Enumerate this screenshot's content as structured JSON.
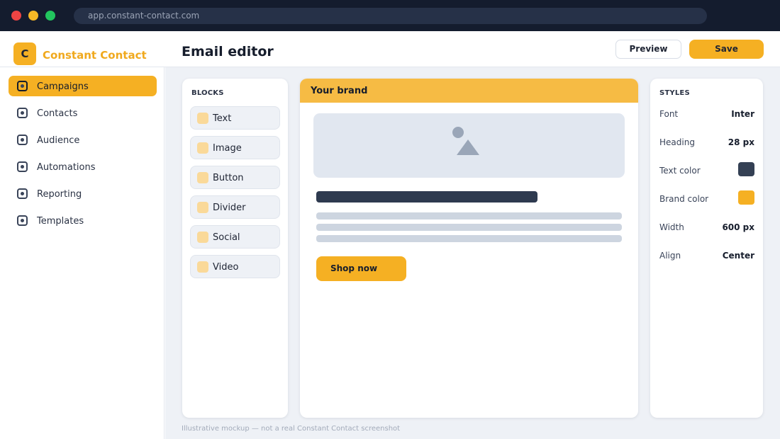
{
  "browser": {
    "url": "app.constant-contact.com"
  },
  "brand": {
    "logo_letter": "C",
    "name": "Constant Contact"
  },
  "header": {
    "title": "Email editor",
    "preview_label": "Preview",
    "save_label": "Save"
  },
  "sidebar": {
    "items": [
      {
        "label": "Campaigns",
        "active": true,
        "icon": "campaigns-icon"
      },
      {
        "label": "Contacts",
        "active": false,
        "icon": "contacts-icon"
      },
      {
        "label": "Audience",
        "active": false,
        "icon": "audience-icon"
      },
      {
        "label": "Automations",
        "active": false,
        "icon": "automations-icon"
      },
      {
        "label": "Reporting",
        "active": false,
        "icon": "reporting-icon"
      },
      {
        "label": "Templates",
        "active": false,
        "icon": "templates-icon"
      }
    ]
  },
  "blocks": {
    "heading": "BLOCKS",
    "items": [
      {
        "label": "Text"
      },
      {
        "label": "Image"
      },
      {
        "label": "Button"
      },
      {
        "label": "Divider"
      },
      {
        "label": "Social"
      },
      {
        "label": "Video"
      }
    ]
  },
  "canvas": {
    "header": "Your brand",
    "image_placeholder_icon": "image-icon",
    "button_label": "Shop now"
  },
  "styles": {
    "heading": "STYLES",
    "font": {
      "label": "Font",
      "value": "Inter"
    },
    "heading_size": {
      "label": "Heading",
      "value": "28 px"
    },
    "text_color": {
      "label": "Text color",
      "value": "#344054"
    },
    "brand_color": {
      "label": "Brand color",
      "value": "#f5b023"
    },
    "width": {
      "label": "Width",
      "value": "600 px"
    },
    "align": {
      "label": "Align",
      "value": "Center"
    }
  },
  "colors": {
    "accent": "#f5b023",
    "chrome": "#141c2e",
    "workspace_bg": "#eef1f6"
  },
  "footnote": "Illustrative mockup — not a real Constant Contact screenshot"
}
